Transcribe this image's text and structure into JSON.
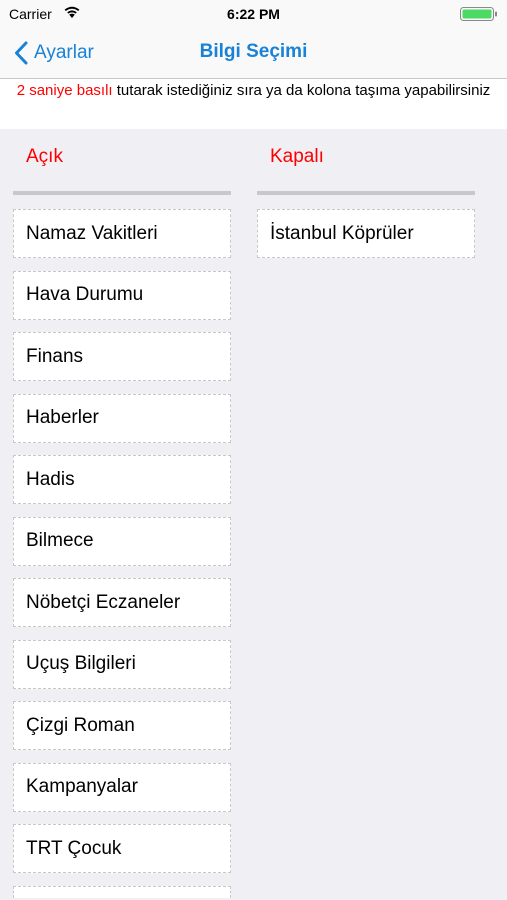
{
  "status": {
    "carrier": "Carrier",
    "time": "6:22 PM"
  },
  "nav": {
    "back_label": "Ayarlar",
    "title": "Bilgi Seçimi"
  },
  "info": {
    "highlight": "2 saniye basılı",
    "rest": " tutarak istediğiniz sıra ya da kolona taşıma yapabilirsiniz"
  },
  "columns": {
    "open": {
      "title": "Açık",
      "items": [
        "Namaz Vakitleri",
        "Hava Durumu",
        "Finans",
        "Haberler",
        "Hadis",
        "Bilmece",
        "Nöbetçi Eczaneler",
        "Uçuş Bilgileri",
        "Çizgi Roman",
        "Kampanyalar",
        "TRT Çocuk"
      ]
    },
    "closed": {
      "title": "Kapalı",
      "items": [
        "İstanbul Köprüler"
      ]
    }
  },
  "colors": {
    "accent": "#1a82d6",
    "highlight": "#ff0000",
    "battery": "#4cd964"
  }
}
